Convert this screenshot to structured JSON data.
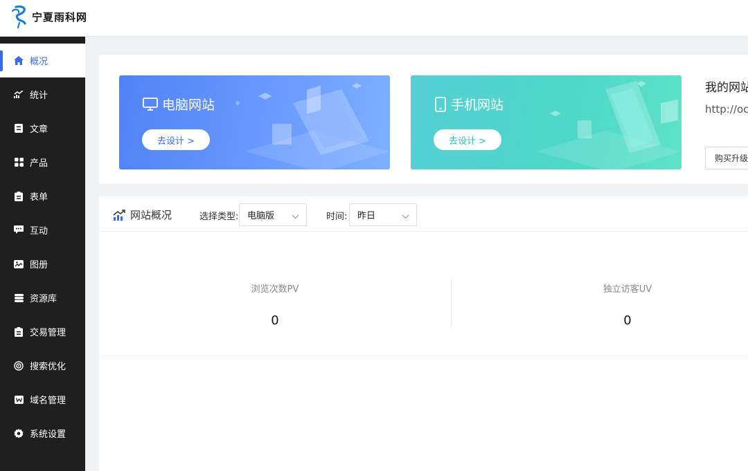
{
  "header": {
    "logo_text": "宁夏雨科网"
  },
  "sidebar": {
    "items": [
      {
        "label": "概况",
        "icon": "home-icon",
        "active": true
      },
      {
        "label": "统计",
        "icon": "chart-line-icon"
      },
      {
        "label": "文章",
        "icon": "article-icon"
      },
      {
        "label": "产品",
        "icon": "grid-icon"
      },
      {
        "label": "表单",
        "icon": "clipboard-icon"
      },
      {
        "label": "互动",
        "icon": "chat-icon"
      },
      {
        "label": "图册",
        "icon": "album-icon"
      },
      {
        "label": "资源库",
        "icon": "database-icon"
      },
      {
        "label": "交易管理",
        "icon": "clipboard-icon"
      },
      {
        "label": "搜索优化",
        "icon": "target-icon"
      },
      {
        "label": "域名管理",
        "icon": "domain-icon"
      },
      {
        "label": "系统设置",
        "icon": "gear-icon"
      }
    ]
  },
  "banners": {
    "pc": {
      "title": "电脑网站",
      "button": "去设计 >",
      "icon": "monitor-icon"
    },
    "mobile": {
      "title": "手机网站",
      "button": "去设计 >",
      "icon": "phone-icon"
    }
  },
  "mysite": {
    "title": "我的网站",
    "url": "http://oc",
    "upgrade_button": "购买升级"
  },
  "stats": {
    "title": "网站概况",
    "type_label": "选择类型:",
    "type_value": "电脑版",
    "time_label": "时间:",
    "time_value": "昨日",
    "metrics": [
      {
        "label": "浏览次数PV",
        "value": "0"
      },
      {
        "label": "独立访客UV",
        "value": "0"
      }
    ]
  },
  "colors": {
    "accent": "#3a6be6",
    "sidebar_bg": "#1f1f1f",
    "pc_banner": "#5f90fa",
    "mobile_banner": "#52d5cc"
  }
}
